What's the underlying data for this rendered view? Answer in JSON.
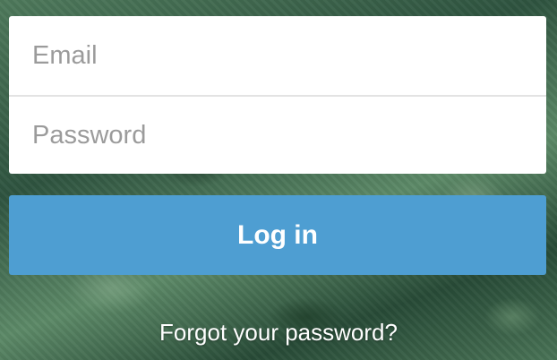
{
  "login_form": {
    "email": {
      "placeholder": "Email",
      "value": ""
    },
    "password": {
      "placeholder": "Password",
      "value": ""
    },
    "submit_label": "Log in",
    "forgot_password_label": "Forgot your password?"
  },
  "colors": {
    "button": "#4e9ed2",
    "panel": "#ffffff",
    "divider": "#e3e3e3",
    "placeholder": "#9b9b9b"
  }
}
